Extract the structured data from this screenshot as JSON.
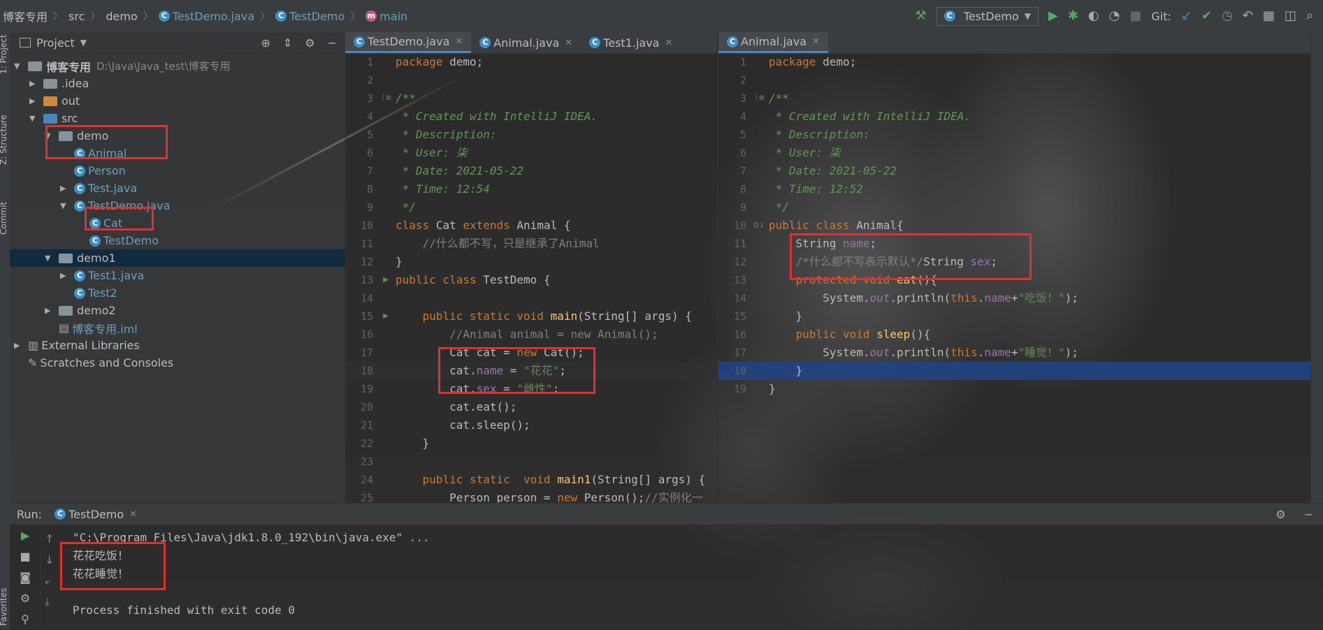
{
  "breadcrumb": {
    "items": [
      {
        "label": "博客专用",
        "icon": "folder-icon"
      },
      {
        "label": "src",
        "icon": "folder-icon"
      },
      {
        "label": "demo",
        "icon": "folder-icon"
      },
      {
        "label": "TestDemo.java",
        "icon": "class-icon"
      },
      {
        "label": "TestDemo",
        "icon": "class-icon"
      },
      {
        "label": "main",
        "icon": "method-icon"
      }
    ]
  },
  "toolbar": {
    "run_config": "TestDemo",
    "git_label": "Git:"
  },
  "side_strip": {
    "project": "1: Project",
    "structure": "Z: Structure",
    "commit": "Commit",
    "favorites": "Favorites"
  },
  "project_panel": {
    "title": "Project",
    "tree": [
      {
        "label": "博客专用",
        "extra": "D:\\Java\\Java_test\\博客专用",
        "indent": 0,
        "arrow": "▼",
        "icon": "module-folder-icon",
        "bold": true
      },
      {
        "label": ".idea",
        "indent": 1,
        "arrow": "▶",
        "icon": "folder-icon"
      },
      {
        "label": "out",
        "indent": 1,
        "arrow": "▶",
        "icon": "folder-orange-icon"
      },
      {
        "label": "src",
        "indent": 1,
        "arrow": "▼",
        "icon": "folder-blue-icon"
      },
      {
        "label": "demo",
        "indent": 2,
        "arrow": "▼",
        "icon": "package-icon"
      },
      {
        "label": "Animal",
        "indent": 3,
        "arrow": "",
        "icon": "class-icon",
        "cyan": true
      },
      {
        "label": "Person",
        "indent": 3,
        "arrow": "",
        "icon": "class-icon",
        "cyan": true
      },
      {
        "label": "Test.java",
        "indent": 3,
        "arrow": "▶",
        "icon": "class-icon",
        "cyan": true
      },
      {
        "label": "TestDemo.java",
        "indent": 3,
        "arrow": "▼",
        "icon": "class-icon",
        "cyan": true
      },
      {
        "label": "Cat",
        "indent": 4,
        "arrow": "",
        "icon": "class-icon",
        "cyan": true
      },
      {
        "label": "TestDemo",
        "indent": 4,
        "arrow": "",
        "icon": "class-icon",
        "cyan": true
      },
      {
        "label": "demo1",
        "indent": 2,
        "arrow": "▼",
        "icon": "package-icon",
        "selected": true
      },
      {
        "label": "Test1.java",
        "indent": 3,
        "arrow": "▶",
        "icon": "class-icon",
        "cyan": true
      },
      {
        "label": "Test2",
        "indent": 3,
        "arrow": "",
        "icon": "class-icon",
        "cyan": true
      },
      {
        "label": "demo2",
        "indent": 2,
        "arrow": "▶",
        "icon": "package-icon"
      },
      {
        "label": "博客专用.iml",
        "indent": 2,
        "arrow": "",
        "icon": "iml-file-icon",
        "cyan": true
      },
      {
        "label": "External Libraries",
        "indent": 0,
        "arrow": "▶",
        "icon": "libraries-icon"
      },
      {
        "label": "Scratches and Consoles",
        "indent": 0,
        "arrow": "",
        "icon": "scratches-icon"
      }
    ]
  },
  "left_editor": {
    "tabs": [
      {
        "label": "TestDemo.java",
        "active": true
      },
      {
        "label": "Animal.java",
        "active": false
      },
      {
        "label": "Test1.java",
        "active": false
      }
    ],
    "lines": [
      {
        "n": "1",
        "html": "<span class='kw'>package</span> demo;"
      },
      {
        "n": "2",
        "html": ""
      },
      {
        "n": "3",
        "html": "<span class='cm'>/**</span>",
        "gut": "⁞≡"
      },
      {
        "n": "4",
        "html": "<span class='cm'> * Created with IntelliJ IDEA.</span>"
      },
      {
        "n": "5",
        "html": "<span class='cm'> * Description:</span>"
      },
      {
        "n": "6",
        "html": "<span class='cm'> * User: 柒</span>"
      },
      {
        "n": "7",
        "html": "<span class='cm'> * Date: 2021-05-22</span>"
      },
      {
        "n": "8",
        "html": "<span class='cm'> * Time: 12:54</span>"
      },
      {
        "n": "9",
        "html": "<span class='cm'> */</span>"
      },
      {
        "n": "10",
        "html": "<span class='kw'>class</span> Cat <span class='kw'>extends</span> Animal {"
      },
      {
        "n": "11",
        "html": "    <span class='lc'>//什么都不写，只是继承了Animal</span>"
      },
      {
        "n": "12",
        "html": "}"
      },
      {
        "n": "13",
        "html": "<span class='kw'>public class</span> TestDemo {",
        "gut": "▶"
      },
      {
        "n": "14",
        "html": ""
      },
      {
        "n": "15",
        "html": "    <span class='kw'>public static void</span> <span class='mth'>main</span>(String[] args) {",
        "gut": "▶"
      },
      {
        "n": "16",
        "html": "        <span class='lc'>//Animal animal = new Animal();</span>"
      },
      {
        "n": "17",
        "html": "        Cat cat = <span class='kw'>new</span> Cat();"
      },
      {
        "n": "18",
        "html": "        cat.<span class='fld'>name</span> = <span class='str'>\"花花\"</span>;",
        "hl": true
      },
      {
        "n": "19",
        "html": "        cat.<span class='fld'>sex</span> = <span class='str'>\"雌性\"</span>;"
      },
      {
        "n": "20",
        "html": "        cat.eat();"
      },
      {
        "n": "21",
        "html": "        cat.sleep();"
      },
      {
        "n": "22",
        "html": "    }"
      },
      {
        "n": "23",
        "html": ""
      },
      {
        "n": "24",
        "html": "    <span class='kw'>public static</span>  <span class='kw'>void</span> <span class='mth'>main1</span>(String[] args) {"
      },
      {
        "n": "25",
        "html": "        Person person = <span class='kw'>new</span> Person();<span class='lc'>//实例化一</span>"
      }
    ]
  },
  "right_editor": {
    "tabs": [
      {
        "label": "Animal.java",
        "active": true
      }
    ],
    "lines": [
      {
        "n": "1",
        "html": "<span class='kw'>package</span> demo;"
      },
      {
        "n": "2",
        "html": ""
      },
      {
        "n": "3",
        "html": "<span class='cm'>/**</span>",
        "gut": "⁞≡"
      },
      {
        "n": "4",
        "html": "<span class='cm'> * Created with IntelliJ IDEA.</span>"
      },
      {
        "n": "5",
        "html": "<span class='cm'> * Description:</span>"
      },
      {
        "n": "6",
        "html": "<span class='cm'> * User: 柒</span>"
      },
      {
        "n": "7",
        "html": "<span class='cm'> * Date: 2021-05-22</span>"
      },
      {
        "n": "8",
        "html": "<span class='cm'> * Time: 12:52</span>"
      },
      {
        "n": "9",
        "html": "<span class='cm'> */</span>"
      },
      {
        "n": "10",
        "html": "<span class='kw'>public class</span> Animal{",
        "gut": "o↓"
      },
      {
        "n": "11",
        "html": "    String <span class='fld'>name</span>;"
      },
      {
        "n": "12",
        "html": "    <span class='lc'>/*什么都不写表示默认*/</span>String <span class='fld'>sex</span>;"
      },
      {
        "n": "13",
        "html": "    <span class='kw'>protected void</span> <span class='mth'>eat</span>(){"
      },
      {
        "n": "14",
        "html": "        System.<span class='st'>out</span>.println(<span class='kw'>this</span>.<span class='fld'>name</span>+<span class='str'>\"吃饭！\"</span>);"
      },
      {
        "n": "15",
        "html": "    }"
      },
      {
        "n": "16",
        "html": "    <span class='kw'>public void</span> <span class='mth'>sleep</span>(){"
      },
      {
        "n": "17",
        "html": "        System.<span class='st'>out</span>.println(<span class='kw'>this</span>.<span class='fld'>name</span>+<span class='str'>\"睡觉！\"</span>);"
      },
      {
        "n": "18",
        "html": "    }",
        "blue": true
      },
      {
        "n": "19",
        "html": "}"
      }
    ]
  },
  "run_panel": {
    "title": "Run:",
    "tab": "TestDemo",
    "output": [
      "\"C:\\Program Files\\Java\\jdk1.8.0_192\\bin\\java.exe\" ...",
      "花花吃饭！",
      "花花睡觉！",
      "",
      "Process finished with exit code 0"
    ]
  },
  "colors": {
    "keyword": "#cc7832",
    "comment": "#629755",
    "string": "#6a8759",
    "field": "#9876aa",
    "annotation_box": "#e03131"
  }
}
